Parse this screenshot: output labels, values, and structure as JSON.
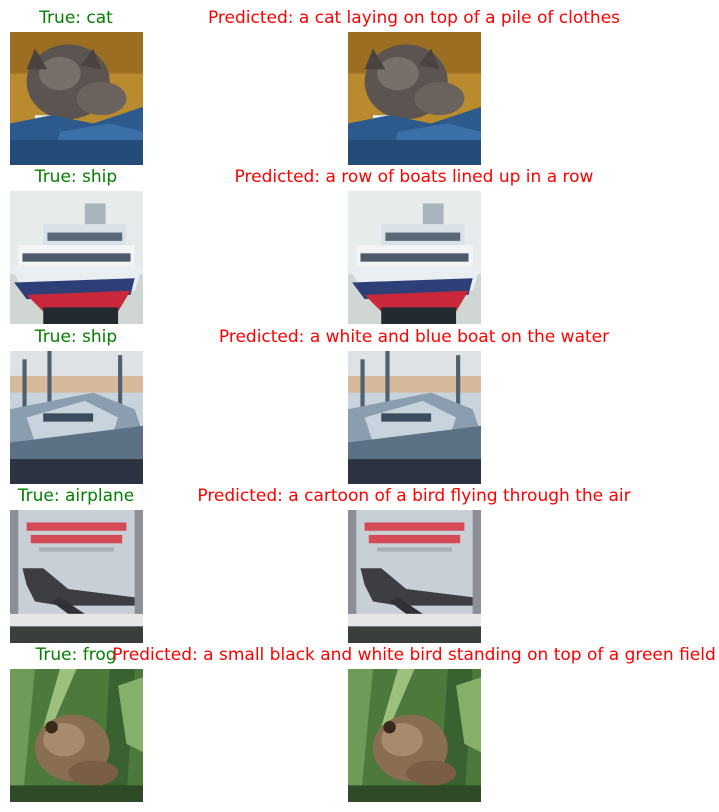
{
  "rows": [
    {
      "true_label": "True: cat",
      "pred_label": "Predicted: a cat laying on top of a pile of clothes",
      "image": "cat-on-blue-cloth"
    },
    {
      "true_label": "True: ship",
      "pred_label": "Predicted: a row of boats lined up in a row",
      "image": "white-ship-red-hull"
    },
    {
      "true_label": "True: ship",
      "pred_label": "Predicted: a white and blue boat on the water",
      "image": "boat-in-harbor"
    },
    {
      "true_label": "True: airplane",
      "pred_label": "Predicted: a cartoon of a bird flying through the air",
      "image": "airplane-poster"
    },
    {
      "true_label": "True: frog",
      "pred_label": "Predicted: a small black and white bird standing on top of a green field",
      "image": "frog-in-grass"
    }
  ],
  "colors": {
    "true_label": "#008000",
    "pred_label": "#ff0000"
  }
}
